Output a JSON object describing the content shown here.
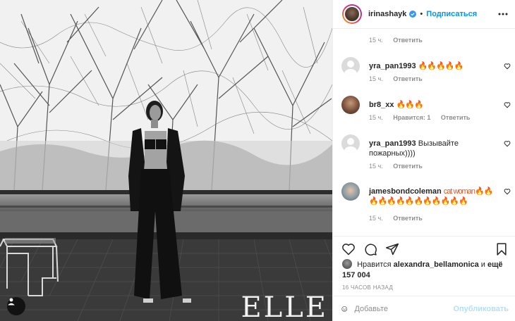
{
  "photo": {
    "watermark": "ELLE"
  },
  "header": {
    "username": "irinashayk",
    "separator": "•",
    "follow_label": "Подписаться"
  },
  "comments": [
    {
      "username": "",
      "text": "",
      "time": "15 ч.",
      "likes": "",
      "reply": "Ответить"
    },
    {
      "username": "yra_pan1993",
      "text": "🔥🔥🔥🔥🔥",
      "time": "15 ч.",
      "likes": "",
      "reply": "Ответить"
    },
    {
      "username": "br8_xx",
      "text": "🔥🔥🔥",
      "time": "15 ч.",
      "likes": "Нравится: 1",
      "reply": "Ответить"
    },
    {
      "username": "yra_pan1993",
      "text": "Вызывайте пожарных))))",
      "time": "15 ч.",
      "likes": "",
      "reply": "Ответить"
    },
    {
      "username": "jamesbondcoleman",
      "text": "cat woman🔥🔥🔥🔥🔥🔥🔥🔥🔥🔥🔥🔥🔥",
      "time": "15 ч.",
      "likes": "",
      "reply": "Ответить"
    }
  ],
  "likes": {
    "prefix": "Нравится",
    "user": "alexandra_bellamonica",
    "conj": "и",
    "more": "ещё 157 004"
  },
  "timeago": "16 ЧАСОВ НАЗАД",
  "add_comment": {
    "placeholder": "Добавьте",
    "publish_label": "Опубликовать"
  },
  "colors": {
    "accent": "#0095f6",
    "publish_disabled": "#b2dffc",
    "meta_gray": "#8e8e8e"
  },
  "icons": [
    "verified-badge-icon",
    "more-options-icon",
    "heart-icon",
    "comment-icon",
    "share-icon",
    "bookmark-icon",
    "smile-icon",
    "tag-user-icon"
  ]
}
